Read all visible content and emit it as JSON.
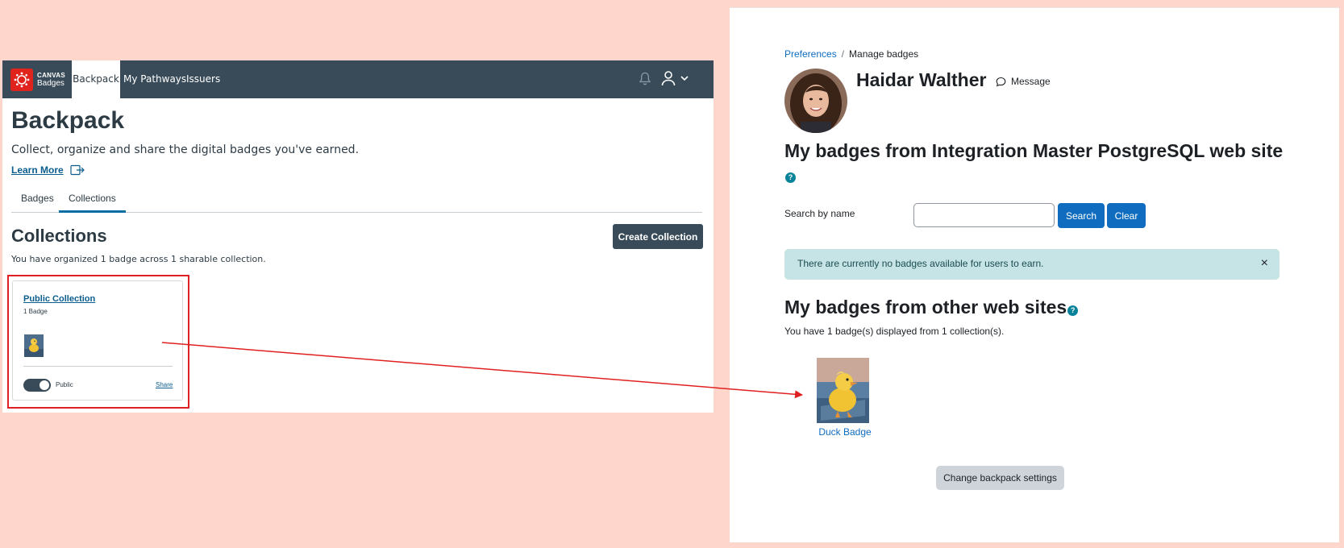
{
  "canvas": {
    "logo": {
      "line1": "CANVAS",
      "line2": "Badges"
    },
    "nav": {
      "backpack": "Backpack",
      "pathways": "My Pathways",
      "issuers": "Issuers"
    },
    "page_title": "Backpack",
    "subtitle": "Collect, organize and share the digital badges you've earned.",
    "learn_more": "Learn More",
    "tabs": [
      "Badges",
      "Collections"
    ],
    "active_tab": "Collections",
    "section_title": "Collections",
    "create_button": "Create Collection",
    "summary": "You have organized 1 badge across 1 sharable collection.",
    "card": {
      "name": "Public Collection",
      "count": "1 Badge",
      "visibility": "Public",
      "share": "Share",
      "toggle_on": true
    }
  },
  "moodle": {
    "breadcrumb": {
      "preferences": "Preferences",
      "separator": "/",
      "current": "Manage badges"
    },
    "user_name": "Haidar Walther",
    "message_link": "Message",
    "heading_site": "My badges from Integration Master PostgreSQL web site",
    "search_label": "Search by name",
    "search_value": "",
    "search_button": "Search",
    "clear_button": "Clear",
    "alert_text": "There are currently no badges available for users to earn.",
    "alert_close": "×",
    "heading_other": "My badges from other web sites",
    "other_summary": "You have 1 badge(s) displayed from 1 collection(s).",
    "badge_name": "Duck Badge",
    "settings_button": "Change backpack settings",
    "help_glyph": "?"
  },
  "colors": {
    "page_bg": "#fed6cc",
    "canvas_nav": "#394b58",
    "canvas_logo": "#e0231c",
    "link_blue": "#0f6cbf",
    "alert_bg": "#c6e3e5",
    "annotation_red": "#e02020"
  }
}
